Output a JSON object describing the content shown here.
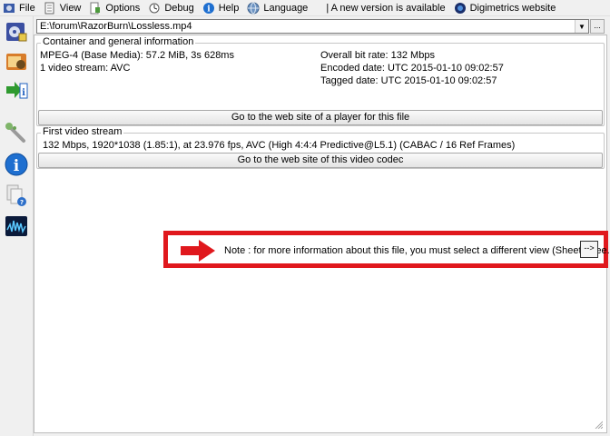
{
  "menu": {
    "file": "File",
    "view": "View",
    "options": "Options",
    "debug": "Debug",
    "help": "Help",
    "language": "Language",
    "new_version": "| A new version is available",
    "website": "Digimetrics website"
  },
  "file_path": "E:\\forum\\RazorBurn\\Lossless.mp4",
  "browse_label": "...",
  "container": {
    "title": "Container and general information",
    "format": "MPEG-4 (Base Media): 57.2 MiB, 3s 628ms",
    "streams": "1 video stream: AVC",
    "bit_rate": "Overall bit rate: 132 Mbps",
    "encoded_date": "Encoded date: UTC 2015-01-10 09:02:57",
    "tagged_date": "Tagged date: UTC 2015-01-10 09:02:57",
    "player_button": "Go to the web site of a player for this file"
  },
  "video": {
    "title": "First video stream",
    "details": "132 Mbps, 1920*1038 (1.85:1), at 23.976 fps, AVC (High 4:4:4 Predictive@L5.1) (CABAC / 16 Ref Frames)",
    "codec_button": "Go to the web site of this video codec"
  },
  "note": {
    "text": "Note : for more information about this file, you must select a different view (Sheet, Tree...)",
    "button": "-->"
  },
  "colors": {
    "highlight": "#e0181d",
    "panel_bg": "#ffffff",
    "window_bg": "#f0f0f0"
  }
}
